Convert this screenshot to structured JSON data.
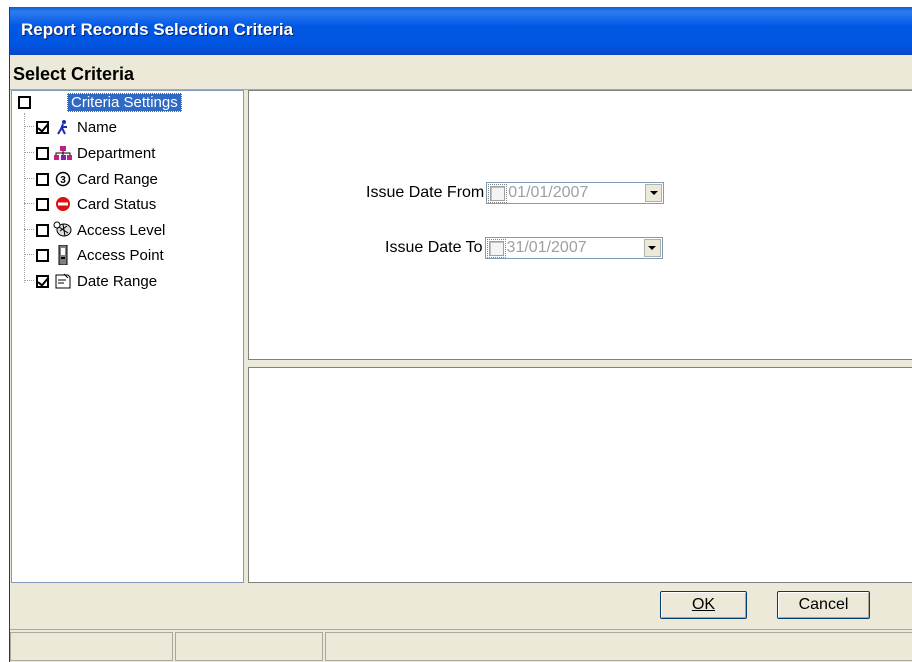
{
  "window": {
    "title": "Report Records Selection Criteria"
  },
  "section": {
    "title": "Select Criteria"
  },
  "tree": {
    "root": {
      "label": "Criteria Settings",
      "checked": false
    },
    "items": [
      {
        "label": "Name",
        "icon": "person-icon",
        "checked": true
      },
      {
        "label": "Department",
        "icon": "department-icon",
        "checked": false
      },
      {
        "label": "Card Range",
        "icon": "card-range-icon",
        "checked": false
      },
      {
        "label": "Card Status",
        "icon": "no-entry-icon",
        "checked": false
      },
      {
        "label": "Access Level",
        "icon": "access-level-icon",
        "checked": false
      },
      {
        "label": "Access Point",
        "icon": "access-point-icon",
        "checked": false
      },
      {
        "label": "Date Range",
        "icon": "calendar-icon",
        "checked": true
      }
    ]
  },
  "date_range": {
    "from_label": "Issue Date From",
    "from_value": "01/01/2007",
    "to_label": "Issue Date To",
    "to_value": "31/01/2007"
  },
  "buttons": {
    "ok": "OK",
    "cancel": "Cancel"
  },
  "colors": {
    "title_bar": "#0055e0",
    "selection": "#316ac5",
    "disabled_text": "#a0a0a0"
  }
}
